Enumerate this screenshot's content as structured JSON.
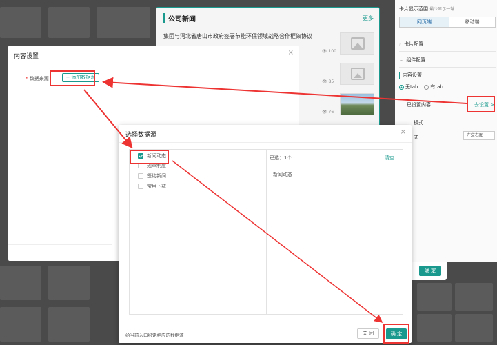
{
  "news_card": {
    "title": "公司新闻",
    "more": "更多",
    "headline": "集团与河北省唐山市政府签署节能环保领域战略合作框架协议",
    "items": [
      {
        "views": "100"
      },
      {
        "views": "85"
      },
      {
        "views": "76"
      }
    ]
  },
  "right_panel": {
    "title": "卡片显示范围",
    "title_hint": "最少显示一端",
    "tabs": [
      "网页端",
      "移动端"
    ],
    "card_config": "卡片配置",
    "component_config": "组件配置",
    "content_settings": "内容设置",
    "radio_notab": "无tab",
    "radio_tab": "有tab",
    "configured_label": "已设置内容",
    "go_settings": "去设置 >",
    "template_style_partial": "板式",
    "style_partial": "式",
    "layout_select": "左文右图"
  },
  "modal_content": {
    "title": "内容设置",
    "close": "×",
    "required_mark": "*",
    "source_label": "数据来源",
    "add_button": "+ 添加数据源"
  },
  "modal_confirm_bg": {
    "ok": "确 定"
  },
  "modal_select": {
    "title": "选择数据源",
    "close": "×",
    "options": [
      {
        "label": "新闻动态",
        "checked": true
      },
      {
        "label": "规章制度",
        "checked": false
      },
      {
        "label": "签约新闻",
        "checked": false
      },
      {
        "label": "常用下载",
        "checked": false
      }
    ],
    "selected_count": "已选：1个",
    "clear": "清空",
    "selected_items": [
      "新闻动态"
    ],
    "hint": "给当前入口绑定相应的数据源",
    "close_btn": "关 闭",
    "ok_btn": "确 定"
  },
  "colors": {
    "accent": "#1a9a8e",
    "annotation": "#e33333"
  }
}
